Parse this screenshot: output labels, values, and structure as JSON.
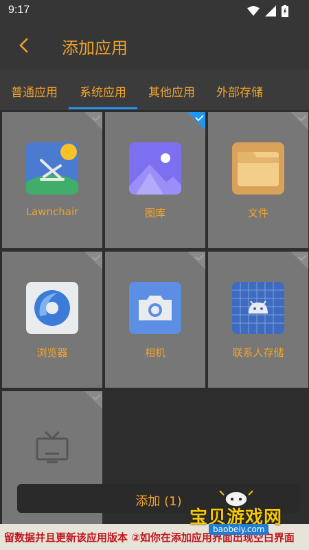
{
  "status_bar": {
    "time": "9:17"
  },
  "toolbar": {
    "title": "添加应用"
  },
  "tabs": [
    "普通应用",
    "系统应用",
    "其他应用",
    "外部存储"
  ],
  "tiles": [
    {
      "label": "Lawnchair",
      "icon": "lawnchair-icon",
      "selected": false
    },
    {
      "label": "图库",
      "icon": "gallery-icon",
      "selected": true
    },
    {
      "label": "文件",
      "icon": "files-icon",
      "selected": false
    },
    {
      "label": "浏览器",
      "icon": "browser-icon",
      "selected": false
    },
    {
      "label": "相机",
      "icon": "camera-icon",
      "selected": false
    },
    {
      "label": "联系人存储",
      "icon": "contacts-storage-icon",
      "selected": false
    },
    {
      "label": "",
      "icon": "tv-icon",
      "selected": false
    }
  ],
  "add_button": {
    "label": "添加 (1)"
  },
  "marquee": "留数据并且更新该应用版本 ②如你在添加应用界面出现空白界面",
  "watermark": {
    "title": "宝贝游戏网",
    "url": "baobeiy.com"
  },
  "colors": {
    "accent": "#f0a32b",
    "tab_indicator": "#2196f3",
    "selected_check": "#2196f3"
  }
}
